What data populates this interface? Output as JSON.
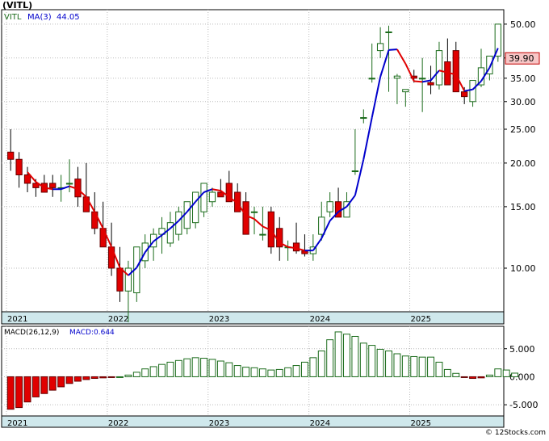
{
  "title": "(VITL)",
  "footer": "© 12Stocks.com",
  "colors": {
    "up": "#1a6b1a",
    "down": "#e00000",
    "ma_up": "#0000cc",
    "ma_down": "#e00000",
    "axis_band": "#cfe8ec",
    "grid": "#bbbbbb",
    "price_badge_bg": "#f7c6c6",
    "price_badge_border": "#c00000"
  },
  "price_panel": {
    "ticker_label": "VITL",
    "ma_label": "MA(3)",
    "ma_value": "44.05",
    "last_price": "39.90",
    "y_ticks": [
      "50.00",
      "40.00",
      "35.00",
      "30.00",
      "25.00",
      "20.00",
      "15.00",
      "10.00"
    ],
    "years": [
      "2021",
      "2022",
      "2023",
      "2024",
      "2025"
    ]
  },
  "macd_panel": {
    "label": "MACD(26,12,9)",
    "value_label": "MACD:0.644",
    "y_ticks": [
      "5.000",
      "0.000",
      "-5.000"
    ],
    "years": [
      "2021",
      "2022",
      "2023",
      "2024",
      "2025"
    ]
  },
  "chart_data": [
    {
      "type": "candlestick",
      "title": "(VITL)",
      "scale": "log",
      "ylim": [
        7.5,
        55
      ],
      "period": "monthly",
      "x": [
        "2021-01",
        "2021-02",
        "2021-03",
        "2021-04",
        "2021-05",
        "2021-06",
        "2021-07",
        "2021-08",
        "2021-09",
        "2021-10",
        "2021-11",
        "2021-12",
        "2022-01",
        "2022-02",
        "2022-03",
        "2022-04",
        "2022-05",
        "2022-06",
        "2022-07",
        "2022-08",
        "2022-09",
        "2022-10",
        "2022-11",
        "2022-12",
        "2023-01",
        "2023-02",
        "2023-03",
        "2023-04",
        "2023-05",
        "2023-06",
        "2023-07",
        "2023-08",
        "2023-09",
        "2023-10",
        "2023-11",
        "2023-12",
        "2024-01",
        "2024-02",
        "2024-03",
        "2024-04",
        "2024-05",
        "2024-06",
        "2024-07",
        "2024-08",
        "2024-09",
        "2024-10",
        "2024-11",
        "2024-12",
        "2025-01",
        "2025-02",
        "2025-03",
        "2025-04",
        "2025-05",
        "2025-06",
        "2025-07",
        "2025-08",
        "2025-09",
        "2025-10",
        "2025-11"
      ],
      "open": [
        21.5,
        20.5,
        18.5,
        17.5,
        17.5,
        17.5,
        17.0,
        17.5,
        18.0,
        16.0,
        14.5,
        13.0,
        11.5,
        10.0,
        8.6,
        8.5,
        10.5,
        11.5,
        12.5,
        11.8,
        12.5,
        13.0,
        13.5,
        14.5,
        15.5,
        16.5,
        17.5,
        16.5,
        15.5,
        14.5,
        12.5,
        14.5,
        13.0,
        11.5,
        11.8,
        11.2,
        11.0,
        12.5,
        14.5,
        15.5,
        14.0,
        19.0,
        27.0,
        35.0,
        42.0,
        47.5,
        35.0,
        32.0,
        35.5,
        35.0,
        34.0,
        33.5,
        39.0,
        42.0,
        32.0,
        30.0,
        33.5,
        36.0,
        40.5,
        39.9
      ],
      "high": [
        25.0,
        21.5,
        19.5,
        18.0,
        18.5,
        18.5,
        18.5,
        20.5,
        19.5,
        20.0,
        16.5,
        15.5,
        13.5,
        11.5,
        10.5,
        10.0,
        12.5,
        13.0,
        14.0,
        14.5,
        15.0,
        15.0,
        16.0,
        16.5,
        17.0,
        18.0,
        19.0,
        17.5,
        16.5,
        15.0,
        15.0,
        15.0,
        14.0,
        12.0,
        13.5,
        12.5,
        12.5,
        15.5,
        16.5,
        17.0,
        16.5,
        25.0,
        28.5,
        44.0,
        49.0,
        49.5,
        36.0,
        32.5,
        37.0,
        40.0,
        38.0,
        44.5,
        45.5,
        44.5,
        33.0,
        33.0,
        42.5,
        39.0,
        50.0,
        52.0,
        41.0
      ],
      "low": [
        19.0,
        17.0,
        16.5,
        16.0,
        16.5,
        16.0,
        15.5,
        16.5,
        15.0,
        15.0,
        12.5,
        11.5,
        9.5,
        8.0,
        7.0,
        8.0,
        10.0,
        10.5,
        11.0,
        11.5,
        12.0,
        12.5,
        13.0,
        14.0,
        15.0,
        16.0,
        15.5,
        15.0,
        13.5,
        12.5,
        12.0,
        11.0,
        10.5,
        10.5,
        11.0,
        10.8,
        10.5,
        12.0,
        14.0,
        14.5,
        14.0,
        18.5,
        26.0,
        34.0,
        40.0,
        32.0,
        29.5,
        29.0,
        34.0,
        28.0,
        31.5,
        32.5,
        36.5,
        33.5,
        29.5,
        29.0,
        33.0,
        34.5,
        39.0,
        36.0,
        38.0
      ],
      "close": [
        20.5,
        18.5,
        17.5,
        17.0,
        16.5,
        17.0,
        17.0,
        17.5,
        16.0,
        14.5,
        13.0,
        11.5,
        10.0,
        8.6,
        10.0,
        11.5,
        11.8,
        12.5,
        13.0,
        13.5,
        14.5,
        15.5,
        16.5,
        17.5,
        16.5,
        16.0,
        15.5,
        14.5,
        12.5,
        14.5,
        12.5,
        11.5,
        11.5,
        11.5,
        11.2,
        11.0,
        11.5,
        14.0,
        15.5,
        14.0,
        15.5,
        19.0,
        27.0,
        35.0,
        44.0,
        47.5,
        35.5,
        32.5,
        35.0,
        35.0,
        33.5,
        42.0,
        33.5,
        32.0,
        31.0,
        34.5,
        37.5,
        40.5,
        50.0,
        40.5,
        39.9
      ]
    },
    {
      "type": "bar",
      "title": "MACD(26,12,9)",
      "ylim": [
        -7,
        9
      ],
      "x": [
        "2021-01",
        "2021-02",
        "2021-03",
        "2021-04",
        "2021-05",
        "2021-06",
        "2021-07",
        "2021-08",
        "2021-09",
        "2021-10",
        "2021-11",
        "2021-12",
        "2022-01",
        "2022-02",
        "2022-03",
        "2022-04",
        "2022-05",
        "2022-06",
        "2022-07",
        "2022-08",
        "2022-09",
        "2022-10",
        "2022-11",
        "2022-12",
        "2023-01",
        "2023-02",
        "2023-03",
        "2023-04",
        "2023-05",
        "2023-06",
        "2023-07",
        "2023-08",
        "2023-09",
        "2023-10",
        "2023-11",
        "2023-12",
        "2024-01",
        "2024-02",
        "2024-03",
        "2024-04",
        "2024-05",
        "2024-06",
        "2024-07",
        "2024-08",
        "2024-09",
        "2024-10",
        "2024-11",
        "2024-12",
        "2025-01",
        "2025-02",
        "2025-03",
        "2025-04",
        "2025-05",
        "2025-06",
        "2025-07",
        "2025-08",
        "2025-09",
        "2025-10",
        "2025-11"
      ],
      "values": [
        -5.8,
        -5.5,
        -4.5,
        -3.6,
        -3.0,
        -2.4,
        -1.8,
        -1.2,
        -0.8,
        -0.5,
        -0.3,
        -0.2,
        -0.1,
        0.0,
        0.3,
        0.8,
        1.4,
        1.8,
        2.2,
        2.6,
        2.9,
        3.2,
        3.4,
        3.3,
        3.1,
        2.8,
        2.5,
        2.0,
        1.7,
        1.6,
        1.4,
        1.2,
        1.3,
        1.6,
        2.0,
        2.6,
        3.4,
        4.6,
        6.6,
        8.0,
        7.6,
        7.2,
        6.0,
        5.6,
        4.9,
        4.6,
        4.1,
        3.7,
        3.6,
        3.5,
        3.5,
        2.6,
        1.3,
        0.6,
        -0.1,
        -0.3,
        -0.2,
        0.3,
        1.4,
        1.2,
        0.644
      ]
    }
  ]
}
